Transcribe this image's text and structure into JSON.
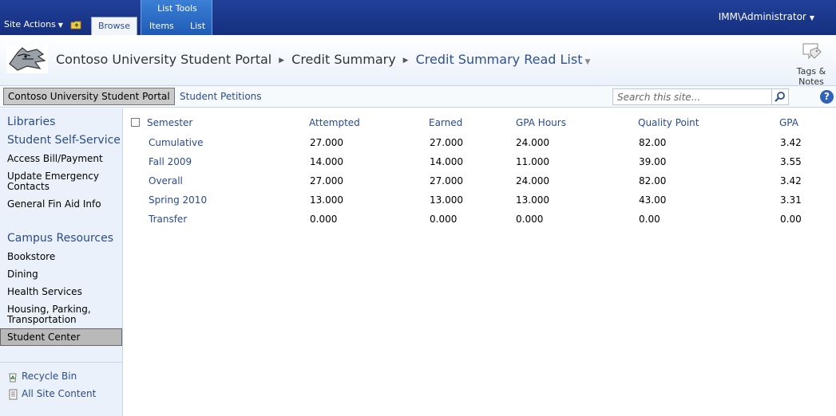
{
  "ribbon": {
    "site_actions": "Site Actions",
    "tab_browse": "Browse",
    "contextual_group": "List Tools",
    "tab_items": "Items",
    "tab_list": "List",
    "user": "IMM\\Administrator"
  },
  "breadcrumb": {
    "site": "Contoso University Student Portal",
    "page": "Credit Summary",
    "current": "Credit Summary Read List"
  },
  "tags_notes": {
    "line1": "Tags &",
    "line2": "Notes"
  },
  "topnav": {
    "home": "Contoso University Student Portal",
    "link1": "Student Petitions"
  },
  "search": {
    "placeholder": "Search this site..."
  },
  "leftnav": {
    "libraries": "Libraries",
    "self_service": "Student Self-Service",
    "self_service_items": [
      "Access Bill/Payment",
      "Update Emergency Contacts",
      "General Fin Aid Info"
    ],
    "campus": "Campus Resources",
    "campus_items": [
      "Bookstore",
      "Dining",
      "Health Services",
      "Housing, Parking, Transportation"
    ],
    "selected": "Student Center",
    "recycle_bin": "Recycle Bin",
    "all_site_content": "All Site Content"
  },
  "table": {
    "headers": [
      "Semester",
      "Attempted",
      "Earned",
      "GPA Hours",
      "Quality Point",
      "GPA"
    ],
    "rows": [
      [
        "Cumulative",
        "27.000",
        "27.000",
        "24.000",
        "82.00",
        "3.42"
      ],
      [
        "Fall 2009",
        "14.000",
        "14.000",
        "11.000",
        "39.00",
        "3.55"
      ],
      [
        "Overall",
        "27.000",
        "27.000",
        "24.000",
        "82.00",
        "3.42"
      ],
      [
        "Spring 2010",
        "13.000",
        "13.000",
        "13.000",
        "43.00",
        "3.31"
      ],
      [
        "Transfer",
        "0.000",
        "0.000",
        "0.000",
        "0.00",
        "0.00"
      ]
    ]
  }
}
